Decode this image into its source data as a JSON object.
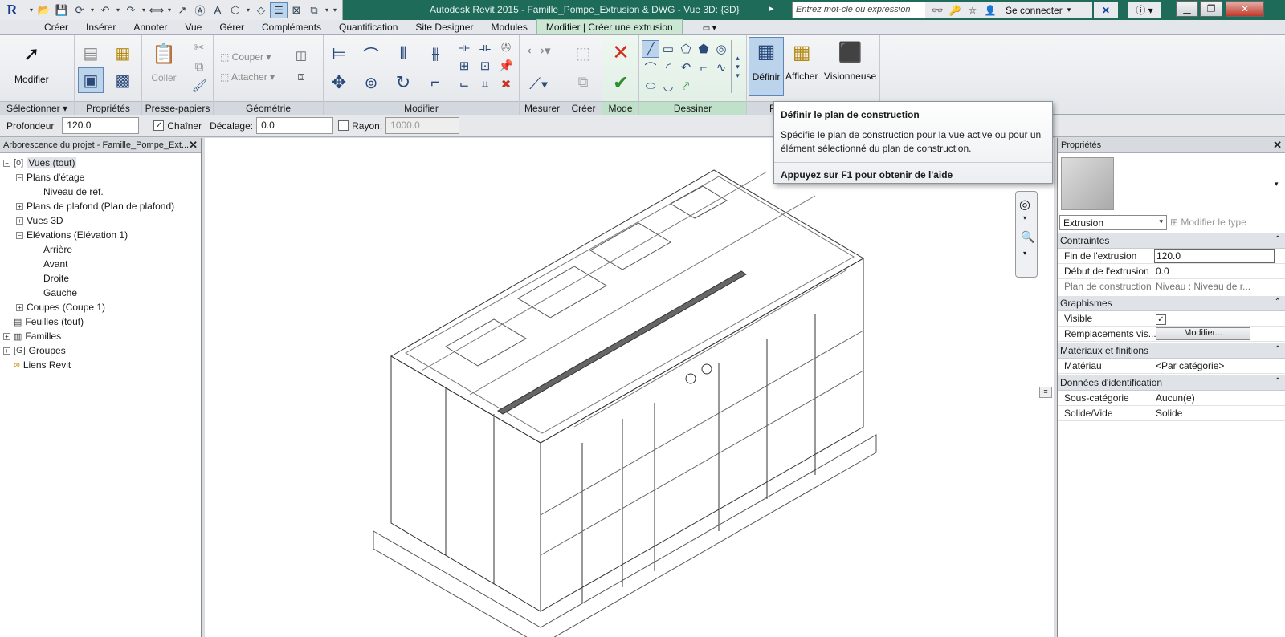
{
  "window": {
    "app_title": "Autodesk Revit 2015  -  Famille_Pompe_Extrusion & DWG - Vue 3D: {3D}",
    "search_placeholder": "Entrez mot-clé ou expression",
    "signin": "Se connecter",
    "logo": "R"
  },
  "tabs": [
    "Créer",
    "Insérer",
    "Annoter",
    "Vue",
    "Gérer",
    "Compléments",
    "Quantification",
    "Site Designer",
    "Modules",
    "Modifier | Créer une extrusion"
  ],
  "ribbon": {
    "select_btn": "Modifier",
    "panels": {
      "select": "Sélectionner",
      "properties": "Propriétés",
      "clipboard": "Presse-papiers",
      "geometry": "Géométrie",
      "modify": "Modifier",
      "measure": "Mesurer",
      "create": "Créer",
      "mode": "Mode",
      "draw": "Dessiner",
      "workplane": "P"
    },
    "clipboard_paste": "Coller",
    "geom_cut": "Couper",
    "geom_join": "Attacher",
    "wp_set": "Définir",
    "wp_show": "Afficher",
    "wp_viewer": "Visionneuse"
  },
  "options": {
    "depth_label": "Profondeur",
    "depth_value": "120.0",
    "chain_label": "Chaîner",
    "chain_checked": true,
    "offset_label": "Décalage:",
    "offset_value": "0.0",
    "radius_label": "Rayon:",
    "radius_value": "1000.0",
    "radius_checked": false
  },
  "browser": {
    "title": "Arborescence du projet - Famille_Pompe_Ext...",
    "nodes": [
      {
        "label": "Vues (tout)",
        "sel": true
      },
      {
        "label": "Plans d'étage"
      },
      {
        "label": "Niveau de réf."
      },
      {
        "label": "Plans de plafond (Plan de plafond)"
      },
      {
        "label": "Vues 3D"
      },
      {
        "label": "Elévations (Elévation 1)"
      },
      {
        "label": "Arrière"
      },
      {
        "label": "Avant"
      },
      {
        "label": "Droite"
      },
      {
        "label": "Gauche"
      },
      {
        "label": "Coupes (Coupe 1)"
      },
      {
        "label": "Feuilles (tout)"
      },
      {
        "label": "Familles"
      },
      {
        "label": "Groupes"
      },
      {
        "label": "Liens Revit"
      }
    ]
  },
  "tooltip": {
    "title": "Définir le plan de construction",
    "body": "Spécifie le plan de construction pour la vue active ou pour un élément sélectionné du plan de construction.",
    "help": "Appuyez sur F1 pour obtenir de l'aide"
  },
  "properties": {
    "title": "Propriétés",
    "type_selector": "Extrusion",
    "edit_type": "Modifier le type",
    "categories": {
      "constraints": "Contraintes",
      "graphics": "Graphismes",
      "materials": "Matériaux et finitions",
      "identity": "Données d'identification"
    },
    "rows": {
      "extrusion_end_k": "Fin de l'extrusion",
      "extrusion_end_v": "120.0",
      "extrusion_start_k": "Début de l'extrusion",
      "extrusion_start_v": "0.0",
      "work_plane_k": "Plan de construction",
      "work_plane_v": "Niveau : Niveau de r...",
      "visible_k": "Visible",
      "overrides_k": "Remplacements vis...",
      "overrides_btn": "Modifier...",
      "material_k": "Matériau",
      "material_v": "<Par catégorie>",
      "subcategory_k": "Sous-catégorie",
      "subcategory_v": "Aucun(e)",
      "solid_void_k": "Solide/Vide",
      "solid_void_v": "Solide"
    }
  }
}
